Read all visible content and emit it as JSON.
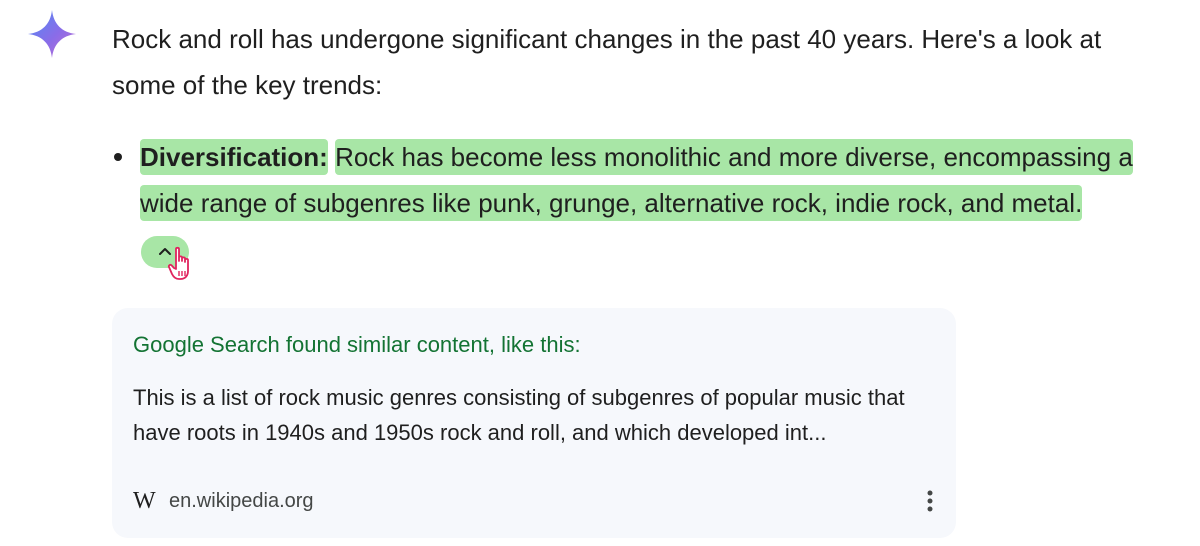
{
  "response": {
    "intro": "Rock and roll has undergone significant changes in the past 40 years. Here's a look at some of the key trends:",
    "bullets": [
      {
        "term": "Diversification:",
        "text": "Rock has become less monolithic and more diverse, encompassing a wide range of subgenres like punk, grunge, alternative rock, indie rock, and metal."
      }
    ]
  },
  "collapse_chip": {
    "icon": "chevron-up-icon"
  },
  "source_card": {
    "heading": "Google Search found similar content, like this:",
    "snippet": "This is a list of rock music genres consisting of subgenres of popular music that have roots in 1940s and 1950s rock and roll, and which developed int...",
    "source_logo": "W",
    "source_domain": "en.wikipedia.org",
    "more_icon": "more-vert-icon"
  },
  "colors": {
    "highlight": "#a8e6a6",
    "heading_green": "#137333",
    "card_background": "#f6f8fc",
    "text": "#1f1f1f"
  }
}
